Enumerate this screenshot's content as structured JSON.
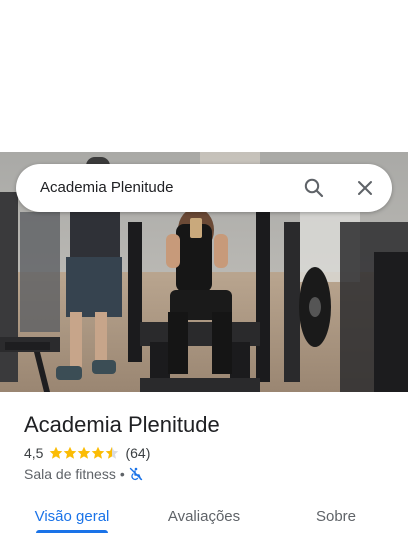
{
  "search": {
    "query": "Academia Plenitude"
  },
  "place": {
    "name": "Academia Plenitude",
    "rating_text": "4,5",
    "rating_value": 4.5,
    "max_rating": 5,
    "reviews_count": "(64)",
    "category": "Sala de fitness",
    "separator": "•"
  },
  "tabs": [
    {
      "label": "Visão geral",
      "active": true
    },
    {
      "label": "Avaliações",
      "active": false
    },
    {
      "label": "Sobre",
      "active": false
    }
  ],
  "colors": {
    "accent": "#1a73e8",
    "star": "#fbbc04",
    "text_primary": "#202124",
    "text_secondary": "#5f6368"
  },
  "icons": {
    "search": "search-icon",
    "close": "close-icon",
    "star": "star-icon",
    "accessibility": "wheelchair-crossed-icon"
  }
}
